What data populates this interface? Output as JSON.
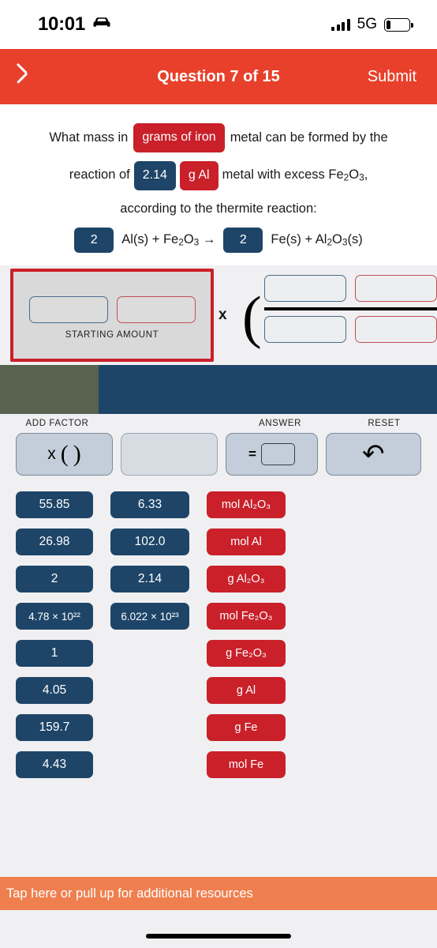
{
  "statusbar": {
    "time": "10:01",
    "car_icon": "car-icon",
    "signal_icon": "cellular-bars-icon",
    "network": "5G",
    "battery_icon": "battery-low-icon",
    "battery_percent": 20
  },
  "navbar": {
    "back_icon": "chevron-left-icon",
    "title": "Question 7 of 15",
    "submit_label": "Submit"
  },
  "question": {
    "line1_part1": "What mass in",
    "line1_chip": "grams of iron",
    "line1_part2": "metal can be formed by the",
    "line2_part1": "reaction of",
    "line2_chip_value": "2.14",
    "line2_chip_unit": "g Al",
    "line2_part2_pre": "metal with excess Fe",
    "line2_part2_sub": "2",
    "line2_part2_mid": "O",
    "line2_part2_sub2": "3",
    "line2_part2_post": ",",
    "line3": "according to the thermite reaction:",
    "equation": {
      "coef_left": "2",
      "reactants": "Al(s) + Fe₂O₃ →",
      "coef_right": "2",
      "products": "Fe(s) + Al₂O₃(s)"
    }
  },
  "workarea": {
    "starting_amount_label": "STARTING AMOUNT",
    "starting_value_slot": "",
    "starting_unit_slot": "",
    "multiply_symbol": "x",
    "paren_symbol": "(",
    "numerator_value_slot": "",
    "numerator_unit_slot": "",
    "denominator_value_slot": "",
    "denominator_unit_slot": ""
  },
  "toolbar": {
    "add_factor_label": "ADD FACTOR",
    "answer_label": "ANSWER",
    "reset_label": "RESET",
    "add_factor_x": "x",
    "paren_open": "(",
    "paren_close": ")",
    "equals_sign": "=",
    "reset_icon": "undo-arrow-icon"
  },
  "tiles": {
    "column1": [
      {
        "label": "55.85",
        "color": "navy"
      },
      {
        "label": "26.98",
        "color": "navy"
      },
      {
        "label": "2",
        "color": "navy"
      },
      {
        "label": "4.78 × 10²²",
        "color": "navy",
        "wide": true
      },
      {
        "label": "1",
        "color": "navy"
      },
      {
        "label": "4.05",
        "color": "navy"
      },
      {
        "label": "159.7",
        "color": "navy"
      },
      {
        "label": "4.43",
        "color": "navy"
      }
    ],
    "column2": [
      {
        "label": "6.33",
        "color": "navy"
      },
      {
        "label": "102.0",
        "color": "navy"
      },
      {
        "label": "2.14",
        "color": "navy"
      },
      {
        "label": "6.022 × 10²³",
        "color": "navy",
        "wide": true
      }
    ],
    "column3": [
      {
        "label": "mol Al₂O₃",
        "color": "red"
      },
      {
        "label": "mol Al",
        "color": "red"
      },
      {
        "label": "g Al₂O₃",
        "color": "red"
      },
      {
        "label": "mol Fe₂O₃",
        "color": "red"
      },
      {
        "label": "g Fe₂O₃",
        "color": "red"
      },
      {
        "label": "g Al",
        "color": "red"
      },
      {
        "label": "g Fe",
        "color": "red"
      },
      {
        "label": "mol Fe",
        "color": "red"
      }
    ]
  },
  "banner": {
    "text": "Tap here or pull up for additional resources"
  },
  "colors": {
    "header_red": "#e8402a",
    "tile_navy": "#1e4568",
    "tile_red": "#c9202a",
    "banner_orange": "#ef7f4f",
    "scroll_olive": "#58624f",
    "page_bg": "#f0f0f2"
  }
}
